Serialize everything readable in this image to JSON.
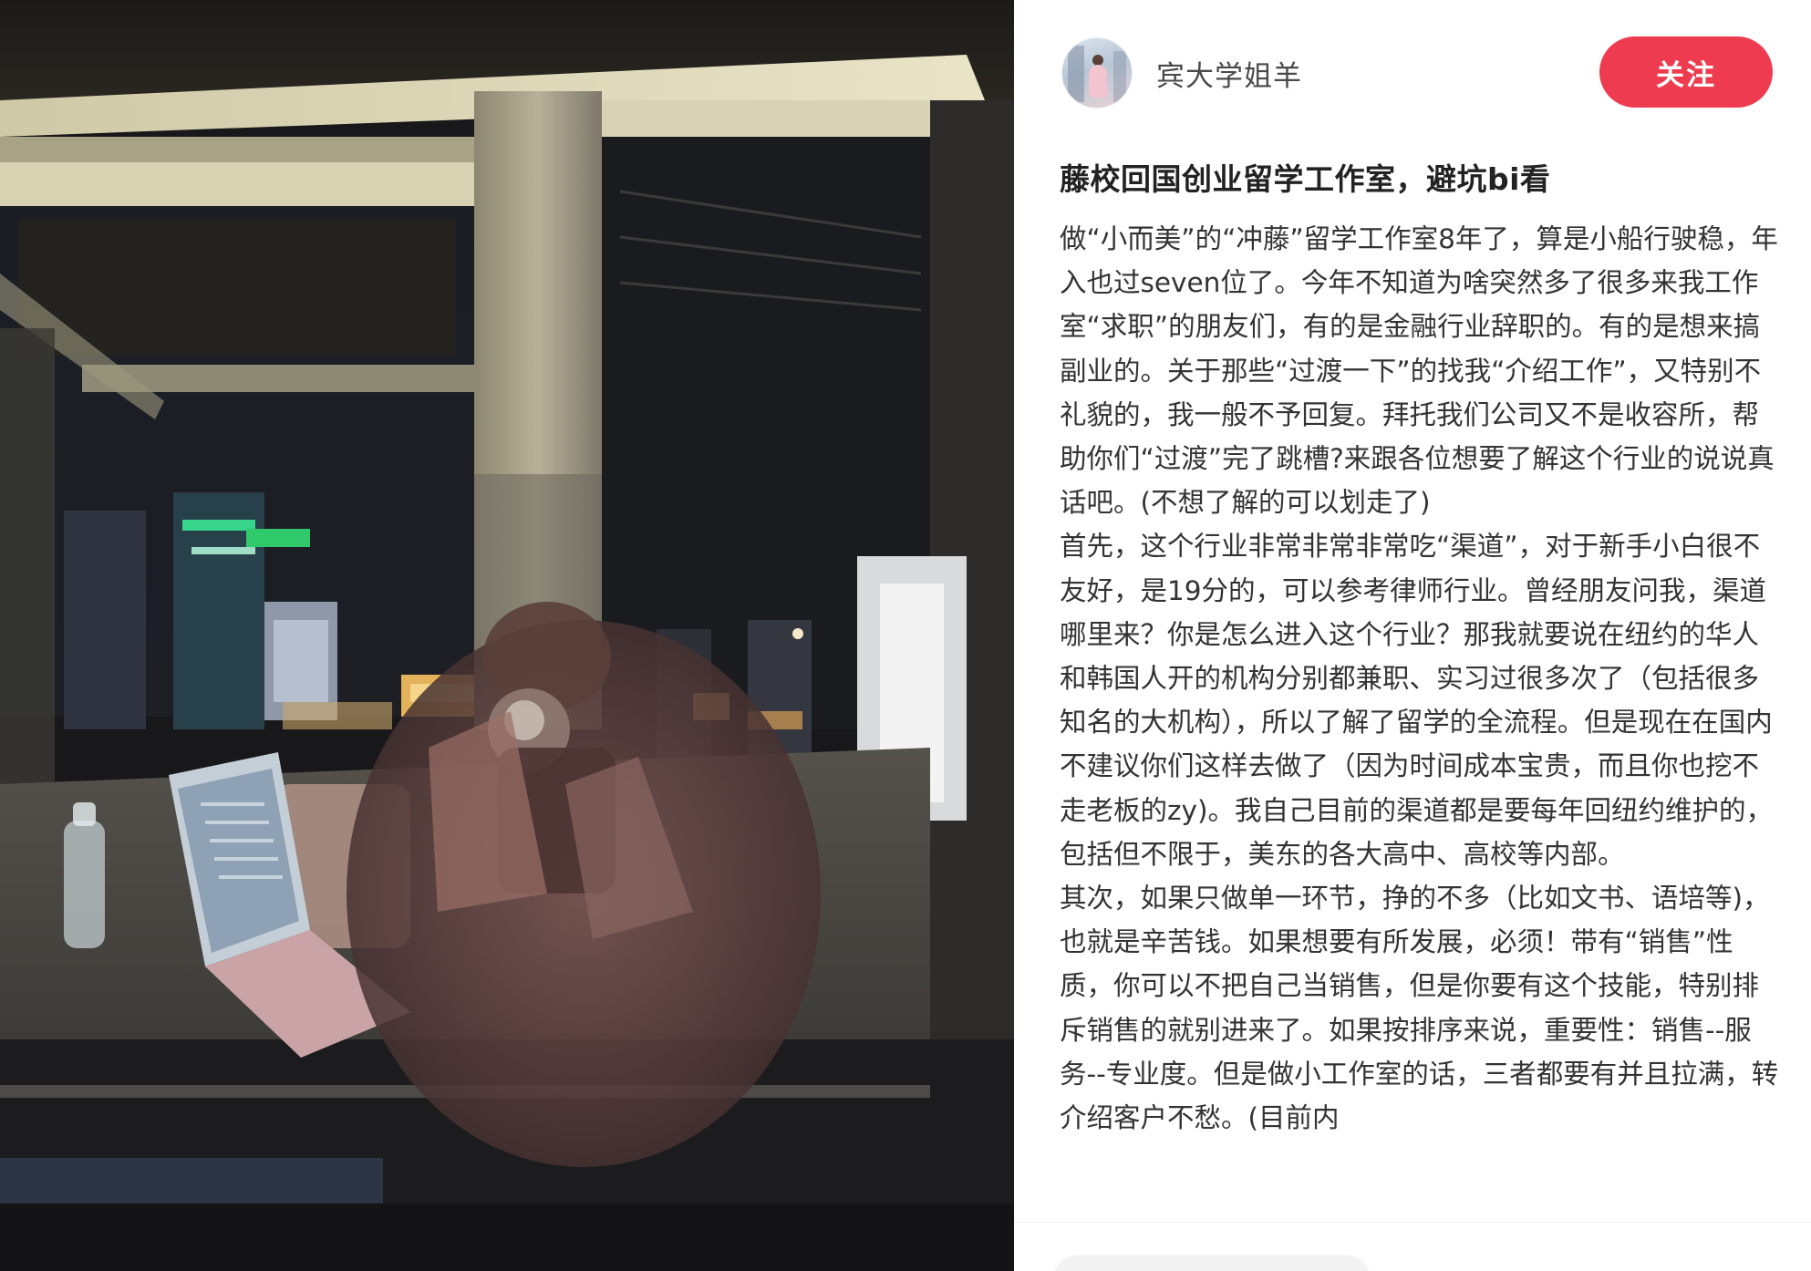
{
  "author": {
    "name": "宾大学姐羊",
    "follow_label": "关注"
  },
  "post": {
    "title": "藤校回国创业留学工作室，避坑bi看",
    "paragraphs": [
      "做“小而美”的“冲藤”留学工作室8年了，算是小船行驶稳，年入也过seven位了。今年不知道为啥突然多了很多来我工作室“求职”的朋友们，有的是金融行业辞职的。有的是想来搞副业的。关于那些“过渡一下”的找我“介绍工作”，又特别不礼貌的，我一般不予回复。拜托我们公司又不是收容所，帮助你们“过渡”完了跳槽?来跟各位想要了解这个行业的说说真话吧。(不想了解的可以划走了)",
      "首先，这个行业非常非常非常吃“渠道”，对于新手小白很不友好，是19分的，可以参考律师行业。曾经朋友问我，渠道哪里来？你是怎么进入这个行业？那我就要说在纽约的华人和韩国人开的机构分别都兼职、实习过很多次了（包括很多知名的大机构），所以了解了留学的全流程。但是现在在国内不建议你们这样去做了（因为时间成本宝贵，而且你也挖不走老板的zy)。我自己目前的渠道都是要每年回纽约维护的，包括但不限于，美东的各大高中、高校等内部。",
      "其次，如果只做单一环节，挣的不多（比如文书、语培等)，也就是辛苦钱。如果想要有所发展，必须！带有“销售”性质，你可以不把自己当销售，但是你要有这个技能，特别排斥销售的就别进来了。如果按排序来说，重要性：销售--服务--专业度。但是做小工作室的话，三者都要有并且拉满，转介绍客户不愁。(目前内"
    ]
  }
}
